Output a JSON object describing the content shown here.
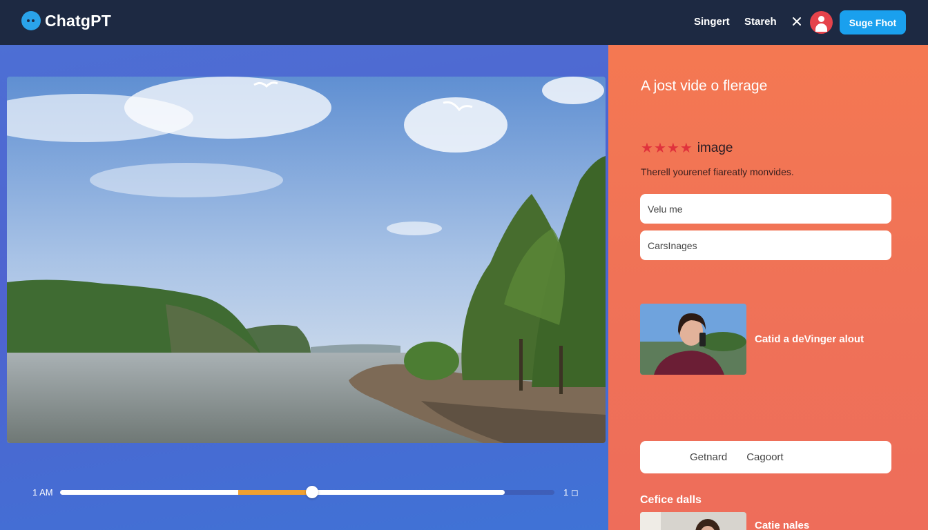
{
  "app": {
    "name": "ChatgPT",
    "logo_icon": "chat-bubble-icon"
  },
  "header": {
    "nav": [
      "Singert",
      "Stareh"
    ],
    "close_icon": "close-icon",
    "avatar_icon": "user-icon",
    "cta_label": "Suge Fhot",
    "colors": {
      "bar": "#1d2942",
      "cta": "#1aa0ee",
      "avatar": "#e5434b"
    }
  },
  "player": {
    "time_current": "1 AM",
    "time_end": "1 ◻",
    "progress": 0.51,
    "buffered": 0.9,
    "highlight_start": 0.36,
    "colors": {
      "track": "#ffffff",
      "highlight": "#f0a030"
    }
  },
  "details": {
    "title": "A jost vide o flerage",
    "rating": {
      "stars": 4,
      "label": "image",
      "star_color": "#e0323c"
    },
    "description": "Therell yourenef fiareatly monvides.",
    "fields": [
      {
        "value": "",
        "placeholder": "Velu me"
      },
      {
        "value": "",
        "placeholder": "CarsInages"
      }
    ],
    "video_card": {
      "label": "Catid a deVinger alout"
    },
    "segments": [
      "Getnard",
      "Cagoort"
    ],
    "section_label": "Cefice dalls",
    "video_card_2": {
      "label": "Catie nales"
    },
    "panel_color": "#f47852"
  }
}
